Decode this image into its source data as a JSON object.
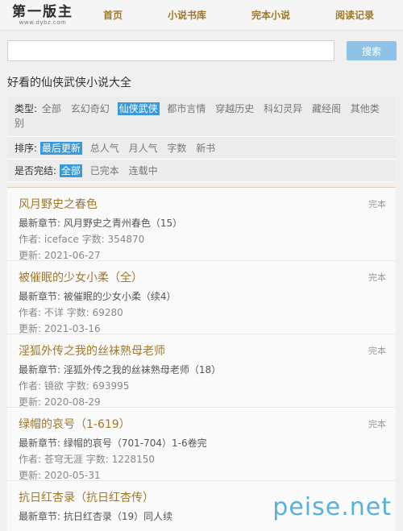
{
  "logo": {
    "text": "第一版主",
    "sub": "www.dybz.com"
  },
  "nav": [
    "首页",
    "小说书库",
    "完本小说",
    "阅读记录"
  ],
  "search": {
    "placeholder": "",
    "button": "搜索"
  },
  "page_title": "好看的仙侠武侠小说大全",
  "filters": {
    "type": {
      "label": "类型:",
      "options": [
        "全部",
        "玄幻奇幻",
        "仙侠武侠",
        "都市言情",
        "穿越历史",
        "科幻灵异",
        "藏经阁",
        "其他类别"
      ],
      "active": 2
    },
    "sort": {
      "label": "排序:",
      "options": [
        "最后更新",
        "总人气",
        "月人气",
        "字数",
        "新书"
      ],
      "active": 0
    },
    "done": {
      "label": "是否完结:",
      "options": [
        "全部",
        "已完本",
        "连载中"
      ],
      "active": 0
    }
  },
  "books": [
    {
      "title": "风月野史之春色",
      "status": "完本",
      "latest_label": "最新章节:",
      "latest": "风月野史之青州春色（15）",
      "author_label": "作者:",
      "author": "iceface",
      "words_label": "字数:",
      "words": "354870",
      "updated_label": "更新:",
      "updated": "2021-06-27"
    },
    {
      "title": "被催眠的少女小柔（全）",
      "status": "完本",
      "latest_label": "最新章节:",
      "latest": "被催眠的少女小柔（续4）",
      "author_label": "作者:",
      "author": "不详",
      "words_label": "字数:",
      "words": "69280",
      "updated_label": "更新:",
      "updated": "2021-03-16"
    },
    {
      "title": "淫狐外传之我的丝袜熟母老师",
      "status": "完本",
      "latest_label": "最新章节:",
      "latest": "淫狐外传之我的丝袜熟母老师（18）",
      "author_label": "作者:",
      "author": "镜欲",
      "words_label": "字数:",
      "words": "693995",
      "updated_label": "更新:",
      "updated": "2020-08-29"
    },
    {
      "title": "绿帽的哀号（1-619）",
      "status": "完本",
      "latest_label": "最新章节:",
      "latest": "绿帽的哀号（701-704）1-6卷完",
      "author_label": "作者:",
      "author": "苍穹无涯",
      "words_label": "字数:",
      "words": "1228150",
      "updated_label": "更新:",
      "updated": "2020-05-31"
    },
    {
      "title": "抗日红杏录（抗日红杏传）",
      "status": "",
      "latest_label": "最新章节:",
      "latest": "抗日红杏录（19）同人续",
      "author_label": "",
      "author": "",
      "words_label": "",
      "words": "",
      "updated_label": "",
      "updated": ""
    }
  ],
  "watermark": "peise.net"
}
